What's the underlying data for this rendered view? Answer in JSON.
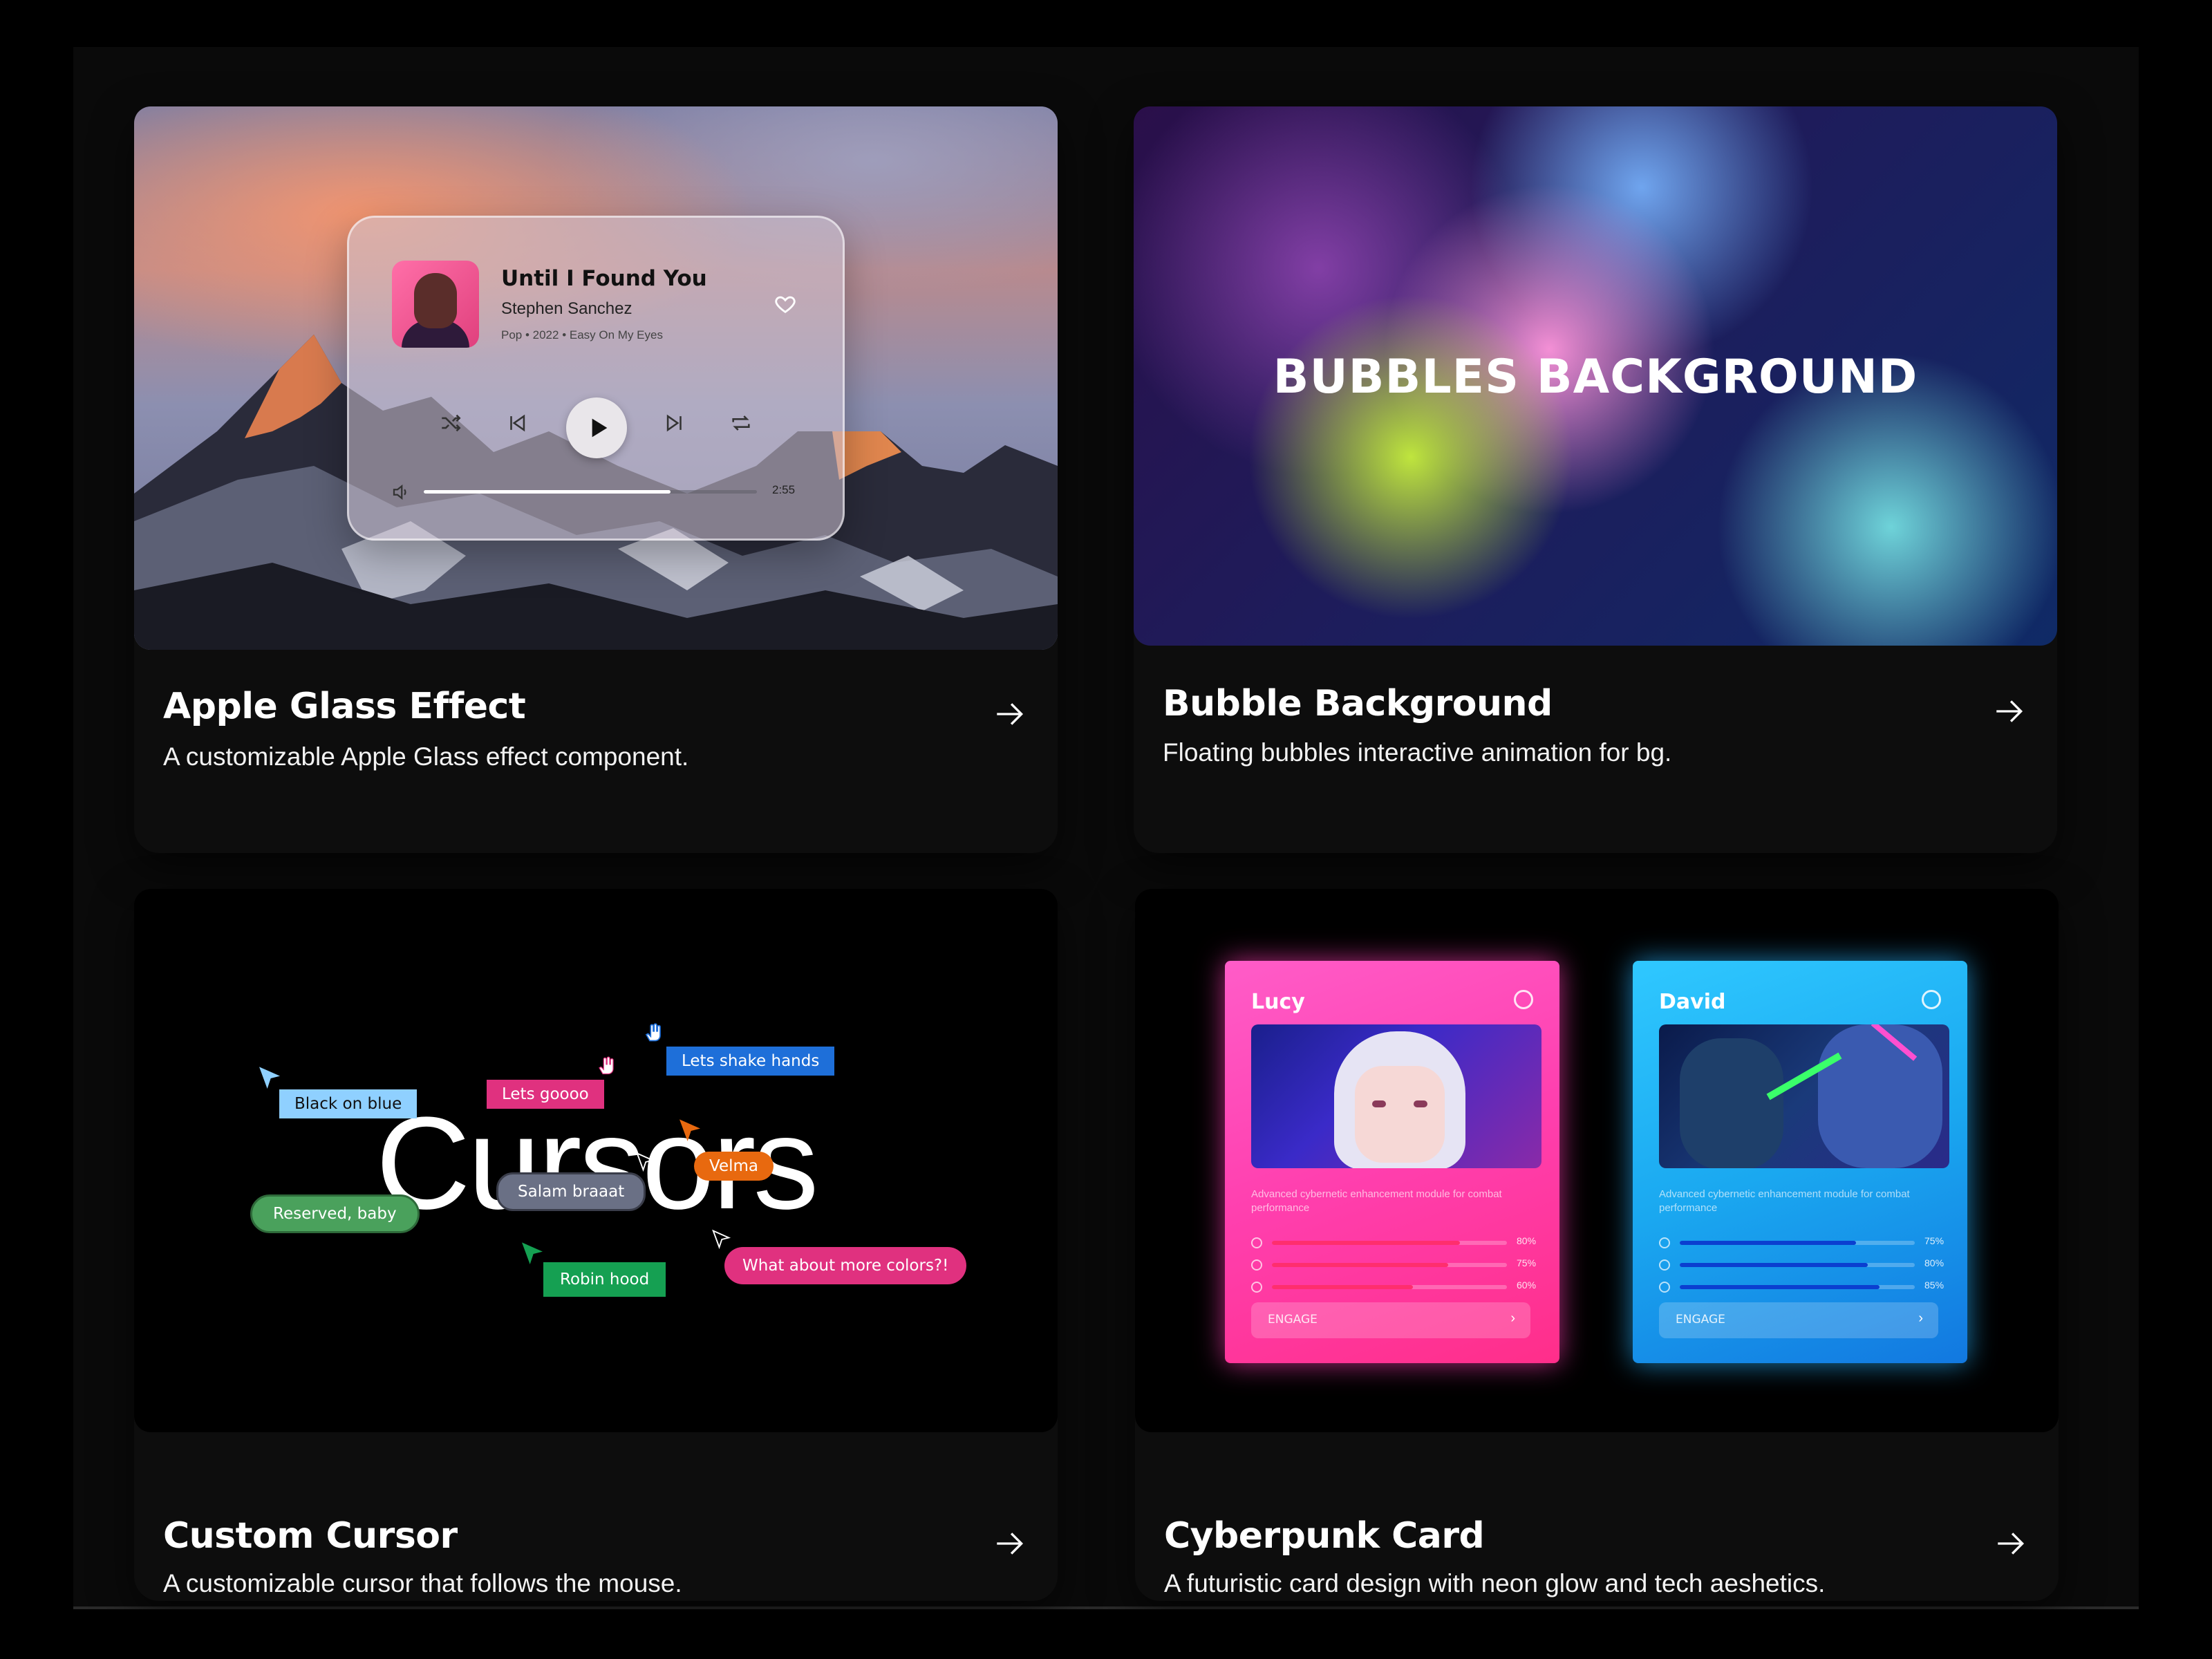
{
  "cards": [
    {
      "title": "Apple Glass Effect",
      "description": "A customizable Apple Glass effect component.",
      "player": {
        "song": "Until I Found You",
        "artist": "Stephen Sanchez",
        "meta": "Pop • 2022 • Easy On My Eyes",
        "time": "2:55",
        "progress": 0.74
      }
    },
    {
      "title": "Bubble Background",
      "description": "Floating bubbles interactive animation for bg.",
      "preview_text": "BUBBLES BACKGROUND"
    },
    {
      "title": "Custom Cursor",
      "description": "A customizable cursor that follows the mouse.",
      "preview_text": "Cursors",
      "tags": [
        {
          "label": "Black on blue",
          "color": "#8fd0ff",
          "text_color": "#111"
        },
        {
          "label": "Lets goooo",
          "color": "#e0317f",
          "text_color": "#fff"
        },
        {
          "label": "Lets shake hands",
          "color": "#1e6fd9",
          "text_color": "#fff"
        },
        {
          "label": "Velma",
          "color": "#e8690f",
          "text_color": "#fff"
        },
        {
          "label": "Salam braaat",
          "color": "#6a7085",
          "text_color": "#fff"
        },
        {
          "label": "Reserved, baby",
          "color": "#4aa15c",
          "text_color": "#fff"
        },
        {
          "label": "Robin hood",
          "color": "#15a052",
          "text_color": "#fff"
        },
        {
          "label": "What about more colors?!",
          "color": "#e0317f",
          "text_color": "#fff"
        }
      ]
    },
    {
      "title": "Cyberpunk Card",
      "description": "A futuristic card design with neon glow and tech aeshetics.",
      "cyber_cards": [
        {
          "name": "Lucy",
          "text": "Advanced cybernetic enhancement module for combat performance",
          "stats": [
            "80%",
            "75%",
            "60%"
          ],
          "stat_values": [
            0.8,
            0.75,
            0.6
          ],
          "button": "ENGAGE"
        },
        {
          "name": "David",
          "text": "Advanced cybernetic enhancement module for combat performance",
          "stats": [
            "75%",
            "80%",
            "85%"
          ],
          "stat_values": [
            0.75,
            0.8,
            0.85
          ],
          "button": "ENGAGE"
        }
      ]
    }
  ]
}
